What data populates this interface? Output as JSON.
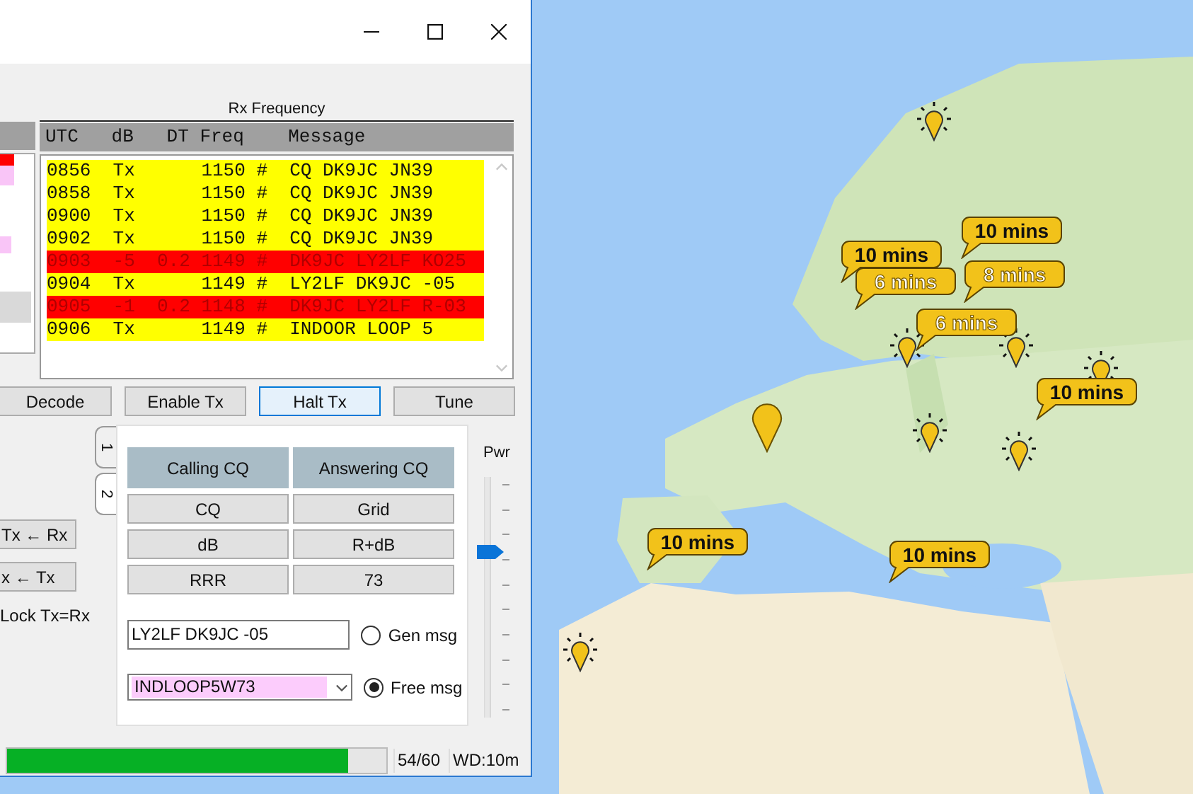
{
  "rx_frequency": {
    "title": "Rx Frequency",
    "columns": [
      "UTC",
      "dB",
      "DT",
      "Freq",
      "Message"
    ],
    "rows": [
      {
        "utc": "0856",
        "db": "Tx",
        "freq": "1150",
        "mark": "#",
        "message": "CQ DK9JC JN39",
        "kind": "tx"
      },
      {
        "utc": "0858",
        "db": "Tx",
        "freq": "1150",
        "mark": "#",
        "message": "CQ DK9JC JN39",
        "kind": "tx"
      },
      {
        "utc": "0900",
        "db": "Tx",
        "freq": "1150",
        "mark": "#",
        "message": "CQ DK9JC JN39",
        "kind": "tx"
      },
      {
        "utc": "0902",
        "db": "Tx",
        "freq": "1150",
        "mark": "#",
        "message": "CQ DK9JC JN39",
        "kind": "tx"
      },
      {
        "utc": "0903",
        "db": "-5",
        "dt": "0.2",
        "freq": "1149",
        "mark": "#",
        "message": "DK9JC LY2LF KO25",
        "kind": "rx"
      },
      {
        "utc": "0904",
        "db": "Tx",
        "freq": "1149",
        "mark": "#",
        "message": "LY2LF DK9JC -05",
        "kind": "tx"
      },
      {
        "utc": "0905",
        "db": "-1",
        "dt": "0.2",
        "freq": "1148",
        "mark": "#",
        "message": "DK9JC LY2LF R-03",
        "kind": "rx"
      },
      {
        "utc": "0906",
        "db": "Tx",
        "freq": "1149",
        "mark": "#",
        "message": "INDOOR LOOP 5",
        "kind": "tx"
      }
    ]
  },
  "action_buttons": [
    {
      "label": "Decode",
      "focused": false
    },
    {
      "label": "Enable Tx",
      "focused": false
    },
    {
      "label": "Halt Tx",
      "focused": true
    },
    {
      "label": "Tune",
      "focused": false
    }
  ],
  "side_buttons": [
    "Tx ← Rx",
    "x ← Tx"
  ],
  "lock_label": "Lock Tx=Rx",
  "tabs": [
    {
      "label": "1",
      "selected": false
    },
    {
      "label": "2",
      "selected": true
    }
  ],
  "message_grid": {
    "headers": [
      "Calling CQ",
      "Answering CQ"
    ],
    "buttons": [
      [
        "CQ",
        "Grid"
      ],
      [
        "dB",
        "R+dB"
      ],
      [
        "RRR",
        "73"
      ]
    ]
  },
  "gen_msg": {
    "value": "LY2LF DK9JC -05",
    "label": "Gen msg",
    "selected": false
  },
  "free_msg": {
    "value": "INDLOOP5W73",
    "label": "Free msg",
    "selected": true
  },
  "power": {
    "label": "Pwr",
    "level": 0.69
  },
  "status_bar": {
    "level": 0.9,
    "count": "54/60",
    "wd": "WD:10m"
  },
  "map_callouts": [
    {
      "label": "10 mins",
      "kind": "dark"
    },
    {
      "label": "10 mins",
      "kind": "dark"
    },
    {
      "label": "6 mins",
      "kind": "light"
    },
    {
      "label": "8 mins",
      "kind": "light"
    },
    {
      "label": "6 mins",
      "kind": "light"
    },
    {
      "label": "10 mins",
      "kind": "dark"
    },
    {
      "label": "10 mins",
      "kind": "dark"
    },
    {
      "label": "10 mins",
      "kind": "dark"
    }
  ]
}
